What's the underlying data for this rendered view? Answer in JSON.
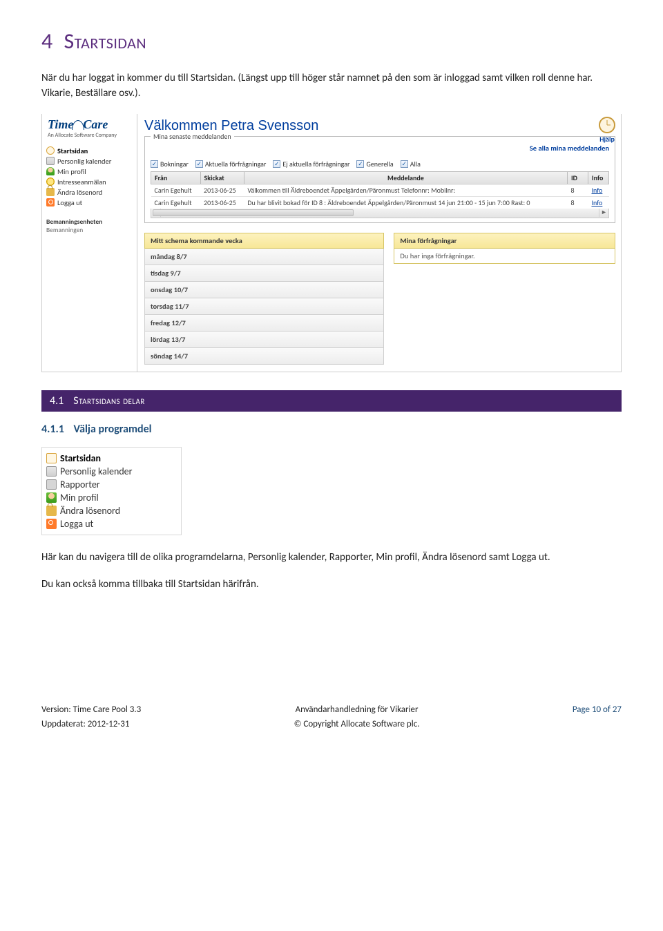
{
  "heading1": {
    "num": "4",
    "text": "Startsidan"
  },
  "intro": "När du har loggat in kommer du till Startsidan. (Längst upp till höger står namnet på den som är inloggad samt vilken roll denne har. Vikarie, Beställare osv.).",
  "shot1": {
    "logo_top": "Time",
    "logo_bottom": "Care",
    "logo_sub": "An Allocate Software Company",
    "welcome": "Välkommen Petra Svensson",
    "help": "Hjälp",
    "nav": [
      {
        "icon": "ico-clock",
        "label": "Startsidan",
        "bold": true
      },
      {
        "icon": "ico-cal",
        "label": "Personlig kalender",
        "bold": false
      },
      {
        "icon": "ico-user",
        "label": "Min profil",
        "bold": false
      },
      {
        "icon": "ico-bulb",
        "label": "Intresseanmälan",
        "bold": false
      },
      {
        "icon": "ico-lock",
        "label": "Ändra lösenord",
        "bold": false
      },
      {
        "icon": "ico-off",
        "label": "Logga ut",
        "bold": false
      }
    ],
    "nav_group_head": "Bemanningsenheten",
    "nav_group_item": "Bemanningen",
    "fieldset_legend": "Mina senaste meddelanden",
    "see_all": "Se alla mina meddelanden",
    "filters": [
      "Bokningar",
      "Aktuella förfrågningar",
      "Ej aktuella förfrågningar",
      "Generella",
      "Alla"
    ],
    "table_headers": [
      "Från",
      "Skickat",
      "Meddelande",
      "ID",
      "Info"
    ],
    "table_rows": [
      {
        "from": "Carin Egehult",
        "sent": "2013-06-25",
        "msg": "Välkommen till Äldreboendet Äppelgården/Päronmust Telefonnr: Mobilnr:",
        "id": "8",
        "info": "Info"
      },
      {
        "from": "Carin Egehult",
        "sent": "2013-06-25",
        "msg": "Du har blivit bokad för ID 8 : Äldreboendet Äppelgården/Päronmust 14 jun 21:00 - 15 jun 7:00 Rast: 0",
        "id": "8",
        "info": "Info"
      }
    ],
    "schedule_title": "Mitt schema kommande vecka",
    "schedule_rows": [
      "måndag 8/7",
      "tisdag 9/7",
      "onsdag 10/7",
      "torsdag 11/7",
      "fredag 12/7",
      "lördag 13/7",
      "söndag 14/7"
    ],
    "requests_title": "Mina förfrågningar",
    "requests_empty": "Du har inga förfrågningar."
  },
  "section": {
    "num": "4.1",
    "text": "Startsidans delar"
  },
  "subhead": {
    "num": "4.1.1",
    "text": "Välja programdel"
  },
  "shot2": {
    "items": [
      {
        "icon": "ico-clock",
        "label": "Startsidan",
        "bold": true
      },
      {
        "icon": "ico-cal",
        "label": "Personlig kalender",
        "bold": false
      },
      {
        "icon": "ico-rep",
        "label": "Rapporter",
        "bold": false
      },
      {
        "icon": "ico-user",
        "label": "Min profil",
        "bold": false
      },
      {
        "icon": "ico-lock",
        "label": "Ändra lösenord",
        "bold": false
      },
      {
        "icon": "ico-off",
        "label": "Logga ut",
        "bold": false
      }
    ]
  },
  "para2": "Här kan du navigera till de olika programdelarna, Personlig kalender, Rapporter, Min profil, Ändra lösenord samt Logga ut.",
  "para3": "Du kan också komma tillbaka till Startsidan härifrån.",
  "footer": {
    "version": "Version: Time Care Pool 3.3",
    "updated": "Uppdaterat: 2012-12-31",
    "center1": "Användarhandledning för Vikarier",
    "center2": "© Copyright Allocate Software plc.",
    "page": "Page 10 of 27"
  }
}
